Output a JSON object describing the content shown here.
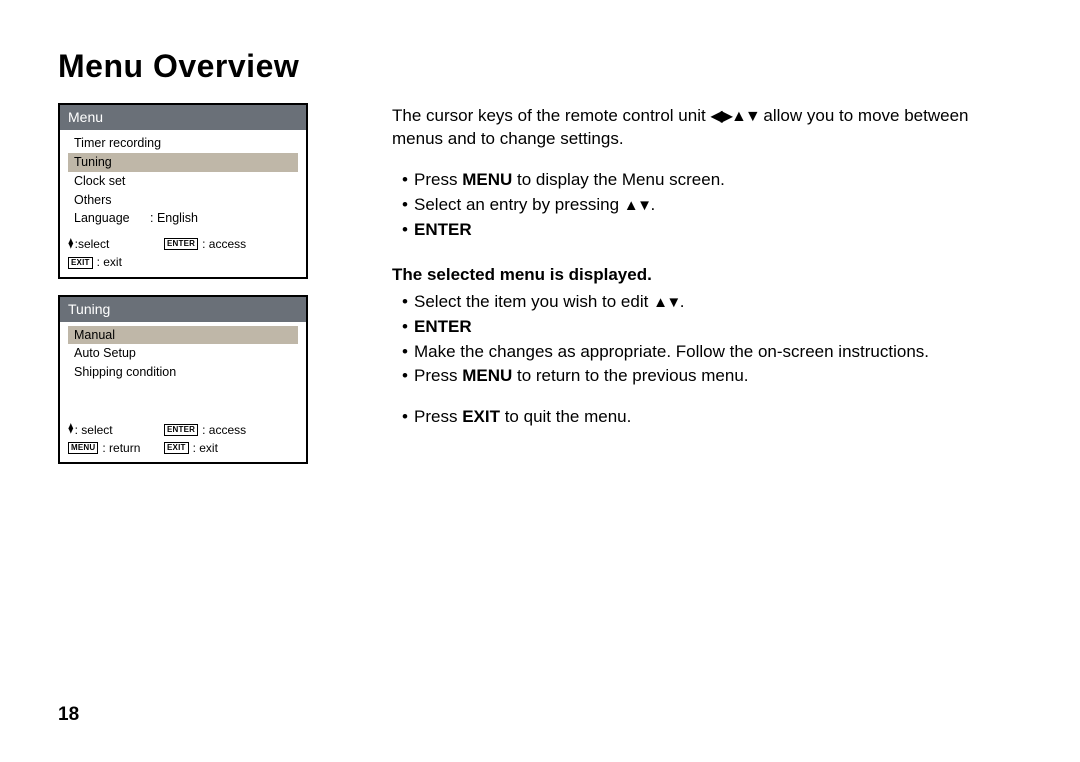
{
  "title": "Menu Overview",
  "page_number": "18",
  "menu1": {
    "header": "Menu",
    "items": [
      "Timer recording",
      "Tuning",
      "Clock set",
      "Others"
    ],
    "selected_index": 1,
    "language_label": "Language",
    "language_value": ": English",
    "footer": {
      "select_prefix": ":select",
      "enter_key": "ENTER",
      "access_text": ": access",
      "exit_key": "EXIT",
      "exit_text": ": exit"
    }
  },
  "menu2": {
    "header": "Tuning",
    "items": [
      "Manual",
      "Auto Setup",
      "Shipping condition"
    ],
    "selected_index": 0,
    "footer": {
      "select_prefix": ": select",
      "enter_key": "ENTER",
      "access_text": ": access",
      "menu_key": "MENU",
      "return_text": ": return",
      "exit_key": "EXIT",
      "exit_text": ": exit"
    }
  },
  "body": {
    "intro_a": "The cursor keys of the remote control unit ",
    "intro_b": " allow you to move between menus and to change settings.",
    "b1_a": "Press ",
    "b1_bold": "MENU",
    "b1_b": " to display the Menu screen.",
    "b2_a": "Select an entry by pressing ",
    "b2_b": ".",
    "b3": "ENTER",
    "subhead": "The selected menu is displayed.",
    "c1_a": "Select the item you wish to edit ",
    "c1_b": ".",
    "c2": "ENTER",
    "c3_a": "Make the changes as appropriate. Follow the on-screen instructions.",
    "c4_a": "Press ",
    "c4_bold": "MENU",
    "c4_b": " to return to the previous menu.",
    "c5_a": "Press ",
    "c5_bold": "EXIT",
    "c5_b": " to quit the menu."
  }
}
